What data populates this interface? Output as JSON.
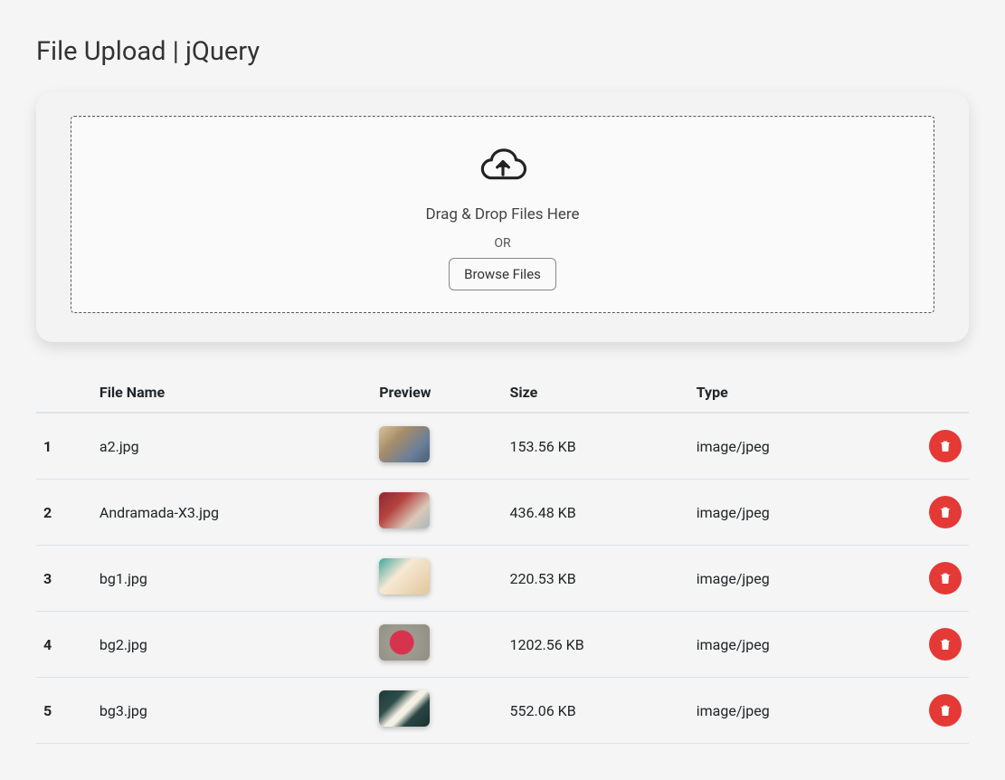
{
  "page": {
    "title": "File Upload | jQuery"
  },
  "upload": {
    "drag_text": "Drag & Drop Files Here",
    "or_text": "OR",
    "browse_label": "Browse Files"
  },
  "table": {
    "headers": {
      "index": "",
      "name": "File Name",
      "preview": "Preview",
      "size": "Size",
      "type": "Type"
    },
    "rows": [
      {
        "index": "1",
        "name": "a2.jpg",
        "size": "153.56 KB",
        "type": "image/jpeg"
      },
      {
        "index": "2",
        "name": "Andramada-X3.jpg",
        "size": "436.48 KB",
        "type": "image/jpeg"
      },
      {
        "index": "3",
        "name": "bg1.jpg",
        "size": "220.53 KB",
        "type": "image/jpeg"
      },
      {
        "index": "4",
        "name": "bg2.jpg",
        "size": "1202.56 KB",
        "type": "image/jpeg"
      },
      {
        "index": "5",
        "name": "bg3.jpg",
        "size": "552.06 KB",
        "type": "image/jpeg"
      }
    ]
  }
}
